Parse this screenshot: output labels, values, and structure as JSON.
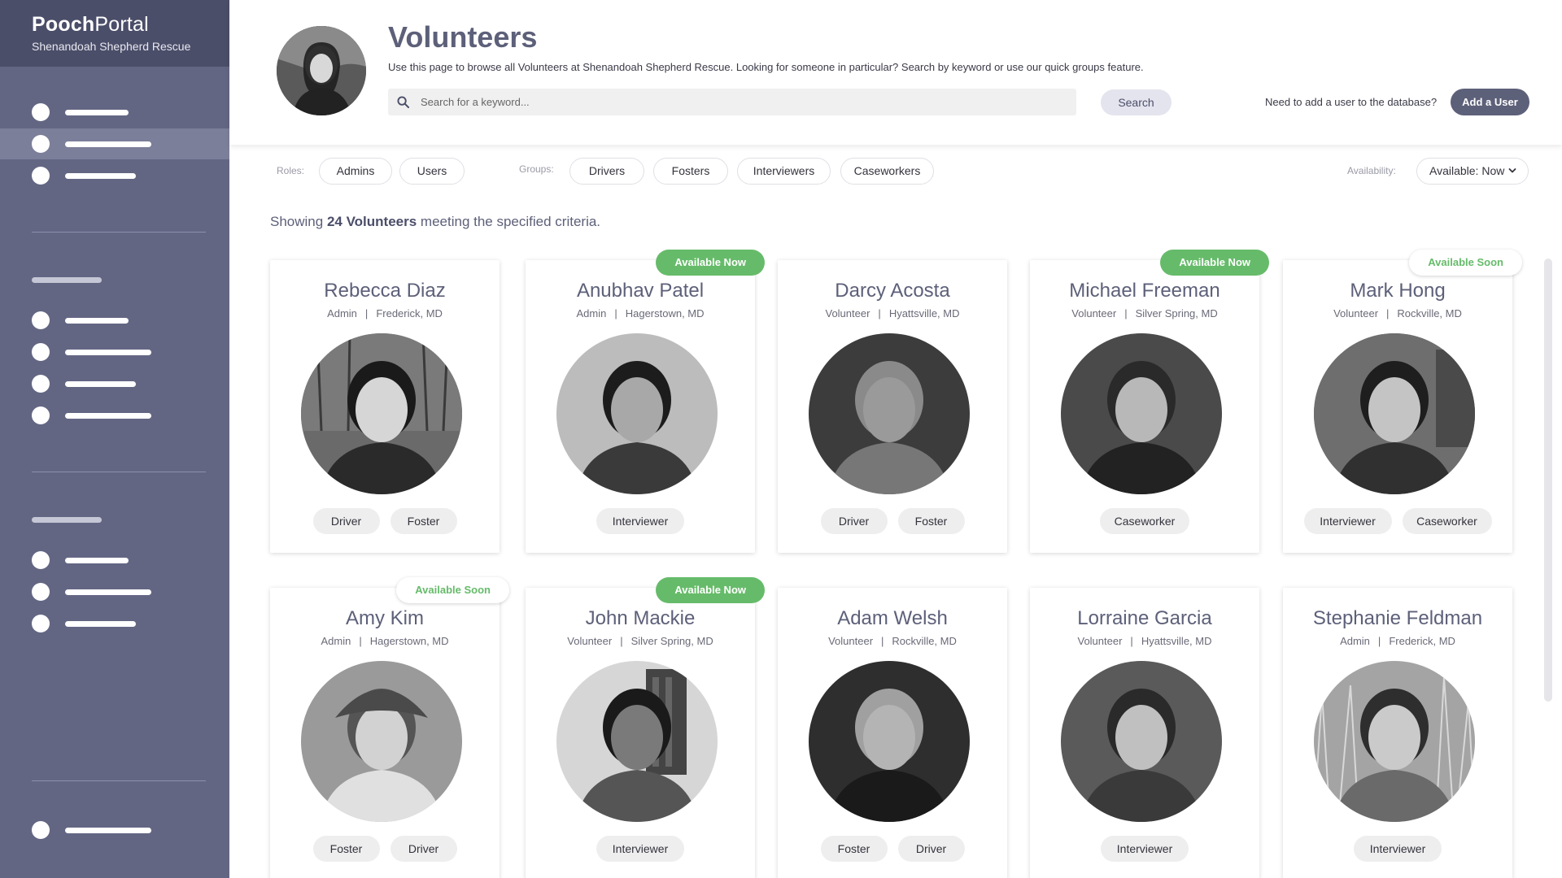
{
  "brand": {
    "name_bold": "Pooch",
    "name_rest": "Portal",
    "subtitle": "Shenandoah Shepherd Rescue"
  },
  "header": {
    "title": "Volunteers",
    "description": "Use this page to browse all Volunteers at Shenandoah Shepherd Rescue. Looking for someone in particular? Search by keyword or use our quick groups feature.",
    "search_placeholder": "Search for a keyword...",
    "search_button": "Search",
    "add_prompt": "Need to add a user to the database?",
    "add_button": "Add a User"
  },
  "filters": {
    "roles_label": "Roles:",
    "roles": [
      "Admins",
      "Users"
    ],
    "groups_label": "Groups:",
    "groups": [
      "Drivers",
      "Fosters",
      "Interviewers",
      "Caseworkers"
    ],
    "availability_label": "Availability:",
    "availability_value": "Available: Now"
  },
  "results": {
    "prefix": "Showing",
    "count_text": "24 Volunteers",
    "suffix": "meeting the specified criteria."
  },
  "cards": [
    {
      "name": "Rebecca Diaz",
      "role": "Admin",
      "location": "Frederick, MD",
      "badge": "",
      "tags": [
        "Driver",
        "Foster"
      ]
    },
    {
      "name": "Anubhav Patel",
      "role": "Admin",
      "location": "Hagerstown, MD",
      "badge": "Available Now",
      "tags": [
        "Interviewer"
      ]
    },
    {
      "name": "Darcy Acosta",
      "role": "Volunteer",
      "location": "Hyattsville, MD",
      "badge": "",
      "tags": [
        "Driver",
        "Foster"
      ]
    },
    {
      "name": "Michael Freeman",
      "role": "Volunteer",
      "location": "Silver Spring, MD",
      "badge": "Available Now",
      "tags": [
        "Caseworker"
      ]
    },
    {
      "name": "Mark Hong",
      "role": "Volunteer",
      "location": "Rockville, MD",
      "badge": "Available Soon",
      "tags": [
        "Interviewer",
        "Caseworker"
      ]
    },
    {
      "name": "Amy Kim",
      "role": "Admin",
      "location": "Hagerstown, MD",
      "badge": "Available Soon",
      "tags": [
        "Foster",
        "Driver"
      ]
    },
    {
      "name": "John Mackie",
      "role": "Volunteer",
      "location": "Silver Spring, MD",
      "badge": "Available Now",
      "tags": [
        "Interviewer"
      ]
    },
    {
      "name": "Adam Welsh",
      "role": "Volunteer",
      "location": "Rockville, MD",
      "badge": "",
      "tags": [
        "Foster",
        "Driver"
      ]
    },
    {
      "name": "Lorraine Garcia",
      "role": "Volunteer",
      "location": "Hyattsville, MD",
      "badge": "",
      "tags": [
        "Interviewer"
      ]
    },
    {
      "name": "Stephanie Feldman",
      "role": "Admin",
      "location": "Frederick, MD",
      "badge": "",
      "tags": [
        "Interviewer"
      ]
    }
  ],
  "meta_separator": "|",
  "colors": {
    "sidebar": "#636683",
    "brand_bar": "#4b4e69",
    "accent": "#5d6079",
    "available_now": "#66bb6a"
  }
}
